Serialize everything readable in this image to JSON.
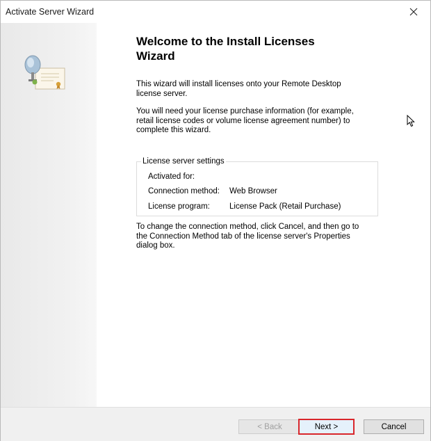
{
  "window": {
    "title": "Activate Server Wizard"
  },
  "content": {
    "heading": "Welcome to the Install Licenses Wizard",
    "intro": "This wizard will install licenses onto your Remote Desktop license server.",
    "info": "You will need your license purchase information (for example, retail license codes or volume license agreement number) to complete this wizard.",
    "settings": {
      "legend": "License server settings",
      "rows": [
        {
          "label": "Activated for:",
          "value": ""
        },
        {
          "label": "Connection method:",
          "value": "Web Browser"
        },
        {
          "label": "License program:",
          "value": "License Pack (Retail Purchase)"
        }
      ]
    },
    "note": "To change the connection method, click Cancel, and then go to the Connection Method tab of the license server's Properties dialog box."
  },
  "footer": {
    "back_label": "< Back",
    "next_label": "Next >",
    "cancel_label": "Cancel"
  },
  "colors": {
    "highlight": "#d9262b"
  },
  "icons": {
    "close": "close-icon",
    "wizard_art": "server-certificate-icon",
    "cursor": "mouse-pointer-icon"
  }
}
